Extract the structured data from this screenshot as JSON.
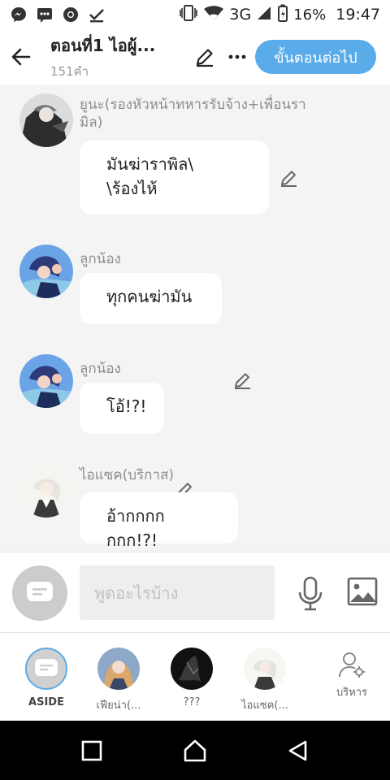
{
  "status_bar": {
    "network": "3G",
    "battery": "16%",
    "time": "19:47"
  },
  "header": {
    "title": "ตอนที่1 ไอผู้...",
    "word_count": "151คำ",
    "next_button": "ขั้นตอนต่อไป"
  },
  "messages": [
    {
      "name": "ยูนะ(รองหัวหน้าทหารรับจ้าง+เพื่อนราพิล)",
      "name_line1": "ยูนะ(รองหัวหน้าทหารรับจ้าง+เพื่อนรา",
      "name_line2": "มิล)",
      "line1": "มันฆ่าราพิล\\",
      "line2": "\\ร้องไห้"
    },
    {
      "name": "ลูกน้อง",
      "text": "ทุกคนฆ่ามัน"
    },
    {
      "name": "ลูกน้อง",
      "text": "โอ้!?!"
    },
    {
      "name": "ไอแซค(บริกาส)",
      "text": "อ้ากกกกกกก!?!"
    }
  ],
  "input": {
    "placeholder": "พูดอะไรบ้าง",
    "value": ""
  },
  "characters": [
    {
      "label": "ASIDE"
    },
    {
      "label": "เฟียน่า(..."
    },
    {
      "label": "???"
    },
    {
      "label": "ไอแซค(..."
    },
    {
      "label": "บริหาร"
    }
  ],
  "colors": {
    "accent": "#5aabe9",
    "background": "#f4f4f4",
    "bubble": "#ffffff"
  }
}
